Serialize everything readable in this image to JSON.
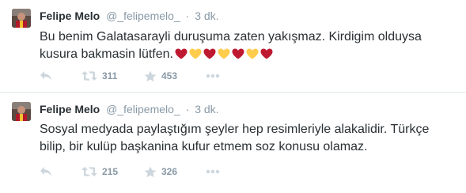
{
  "tweets": [
    {
      "name": "Felipe Melo",
      "handle": "@_felipemelo_",
      "separator": "·",
      "time": "3 dk.",
      "lines": [
        "Bu benim Galatasarayli duruşuma zaten yakışmaz. Kirdigim olduysa",
        "kusura bakmasin lütfen."
      ],
      "emoji": [
        "red-heart",
        "yellow-heart",
        "red-heart",
        "yellow-heart",
        "red-heart",
        "yellow-heart",
        "red-heart"
      ],
      "retweets": "311",
      "favorites": "453"
    },
    {
      "name": "Felipe Melo",
      "handle": "@_felipemelo_",
      "separator": "·",
      "time": "3 dk.",
      "lines": [
        "Sosyal medyada paylaştığım şeyler hep resimleriyle alakalidir. Türkçe",
        "bilip, bir kulüp başkanina kufur etmem soz konusu olamaz."
      ],
      "emoji": [],
      "retweets": "215",
      "favorites": "326"
    }
  ],
  "colors": {
    "red_heart": "#be1931",
    "yellow_heart": "#ffcc4d",
    "icon": "#ccd6dd",
    "meta": "#8899a6",
    "divider": "#e1e8ed"
  },
  "icons": {
    "reply": "reply-icon",
    "retweet": "retweet-icon",
    "favorite": "star-icon",
    "more": "more-dots-icon"
  }
}
